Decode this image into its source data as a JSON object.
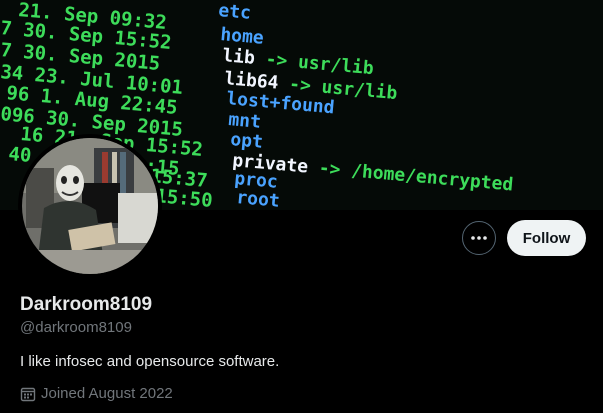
{
  "profile": {
    "display_name": "Darkroom8109",
    "handle": "@darkroom8109",
    "bio": "I like infosec and opensource software.",
    "joined": "Joined August 2022"
  },
  "actions": {
    "follow_label": "Follow",
    "more_icon": "more-dots-icon"
  },
  "banner": {
    "left_lines": [
      "21. Sep 09:32",
      "7 30. Sep 15:52",
      "7 30. Sep 2015",
      "34 23. Jul 10:01",
      "96  1. Aug 22:45",
      "096 30. Sep 2015",
      "16 21. Sep 15:52",
      "40  8. Jul 08:15",
      "15:37",
      "15:50"
    ],
    "right_lines": [
      "etc",
      "home",
      "lib -> usr/lib",
      "lib64 -> usr/lib",
      "lost+found",
      "mnt",
      "opt",
      "private -> /home/encrypted",
      "proc",
      "root"
    ],
    "colors": {
      "green": "#3ddc5a",
      "blue": "#4aa3ff",
      "white": "#f2f6ff"
    }
  },
  "icons": {
    "calendar": "calendar-icon"
  }
}
